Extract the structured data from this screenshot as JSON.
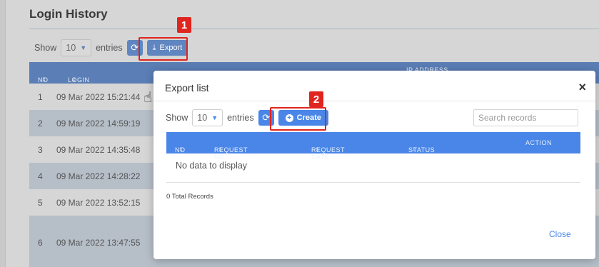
{
  "background": {
    "page_title": "Login History",
    "show_label": "Show",
    "entries_value": "10",
    "entries_label": "entries",
    "export_label": "Export",
    "columns": [
      "NO",
      "LOGIN TIME"
    ],
    "hidden_column_partial": "IP ADDRESS",
    "rows": [
      {
        "no": "1",
        "time": "09 Mar 2022 15:21:44"
      },
      {
        "no": "2",
        "time": "09 Mar 2022 14:59:19"
      },
      {
        "no": "3",
        "time": "09 Mar 2022 14:35:48"
      },
      {
        "no": "4",
        "time": "09 Mar 2022 14:28:22"
      },
      {
        "no": "5",
        "time": "09 Mar 2022 13:52:15"
      },
      {
        "no": "6",
        "time": "09 Mar 2022 13:47:55"
      }
    ]
  },
  "annotations": {
    "step1": "1",
    "step2": "2",
    "highlight_color": "#e0241e"
  },
  "modal": {
    "title": "Export list",
    "close_icon": "×",
    "show_label": "Show",
    "entries_value": "10",
    "entries_label": "entries",
    "create_label": "Create",
    "search_placeholder": "Search records",
    "columns": [
      "NO",
      "REQUEST NO",
      "REQUEST DATE",
      "STATUS",
      "ACTION"
    ],
    "empty_text": "No data to display",
    "total_records": "0 Total Records",
    "close_label": "Close",
    "accent_color": "#4a86e8"
  }
}
